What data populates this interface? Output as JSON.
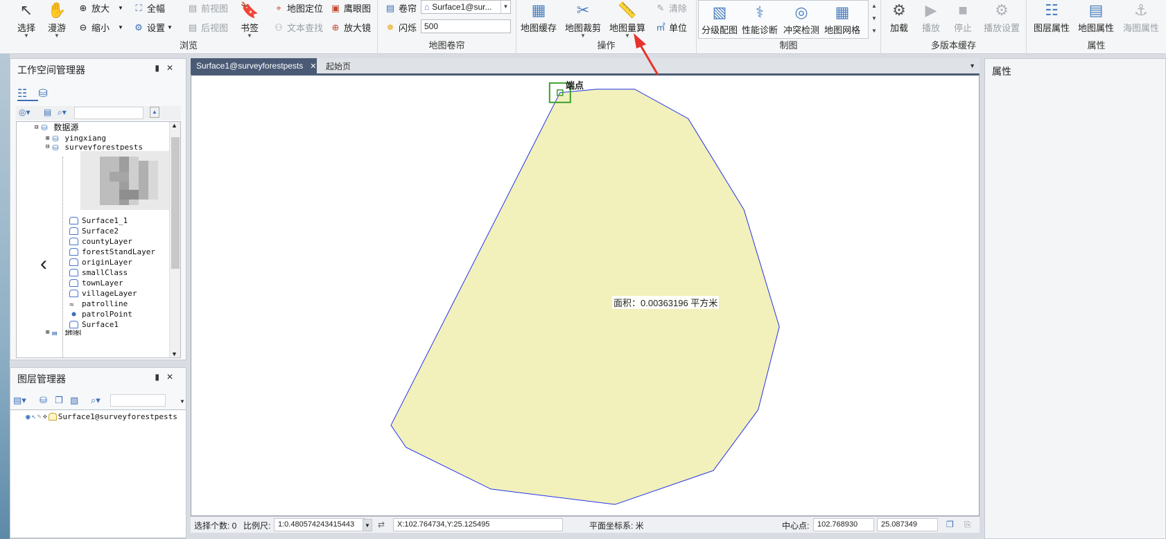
{
  "ribbon": {
    "browse": {
      "label": "浏览",
      "select": "选择",
      "pan": "漫游",
      "zoom_in": "放大",
      "zoom_out": "缩小",
      "full_extent": "全幅",
      "settings": "设置",
      "prev_view": "前视图",
      "next_view": "后视图",
      "bookmark": "书签",
      "locate": "地图定位",
      "eagle_eye": "鹰眼图",
      "text_search": "文本查找",
      "magnifier": "放大镜"
    },
    "swipe": {
      "label": "地图卷帘",
      "swipe": "卷帘",
      "layer_value": "Surface1@sur...",
      "flash": "闪烁",
      "flash_value": "500"
    },
    "ops": {
      "label": "操作",
      "map_cache": "地图缓存",
      "map_clip": "地图裁剪",
      "map_measure": "地图量算",
      "clear": "清除",
      "unit": "单位"
    },
    "mapping": {
      "label": "制图",
      "grade_map": "分级配图",
      "perf_diag": "性能诊断",
      "conflict": "冲突检测",
      "grid": "地图网格"
    },
    "multicache": {
      "label": "多版本缓存",
      "load": "加载",
      "play": "播放",
      "stop": "停止",
      "play_settings": "播放设置"
    },
    "props": {
      "label": "属性",
      "layer_props": "图层属性",
      "map_props": "地图属性",
      "chart_props": "海图属性"
    }
  },
  "workspace": {
    "title": "工作空间管理器",
    "datasource_label": "数据源",
    "items": [
      {
        "label": "yingxiang"
      },
      {
        "label": "surveyforestpests"
      },
      {
        "label": "Surface1_1"
      },
      {
        "label": "Surface2"
      },
      {
        "label": "countyLayer"
      },
      {
        "label": "forestStandLayer"
      },
      {
        "label": "originLayer"
      },
      {
        "label": "smallClass"
      },
      {
        "label": "townLayer"
      },
      {
        "label": "villageLayer"
      },
      {
        "label": "patrolline"
      },
      {
        "label": "patrolPoint"
      },
      {
        "label": "Surface1"
      },
      {
        "label": "地图"
      }
    ]
  },
  "layers": {
    "title": "图层管理器",
    "layer_name": "Surface1@surveyforestpests"
  },
  "tabs": [
    {
      "label": "Surface1@surveyforestpests"
    },
    {
      "label": "起始页"
    }
  ],
  "map": {
    "endpoint_label": "端点",
    "area_label": "面积：0.00363196 平方米",
    "fill_color": "#f2f0bb",
    "stroke_color": "#2233ee",
    "polygon": [
      [
        0.469,
        0.039
      ],
      [
        0.516,
        0.031
      ],
      [
        0.564,
        0.031
      ],
      [
        0.632,
        0.098
      ],
      [
        0.703,
        0.305
      ],
      [
        0.748,
        0.571
      ],
      [
        0.721,
        0.76
      ],
      [
        0.664,
        0.898
      ],
      [
        0.539,
        0.975
      ],
      [
        0.381,
        0.94
      ],
      [
        0.273,
        0.845
      ],
      [
        0.254,
        0.795
      ]
    ],
    "measure_point_color": "#3aa02a"
  },
  "properties": {
    "title": "属性"
  },
  "status": {
    "selected": "选择个数: 0",
    "scale_label": "比例尺:",
    "scale_value": "1:0.480574243415443",
    "coords": "X:102.764734,Y:25.125495",
    "crs": "平面坐标系: 米",
    "center_label": "中心点:",
    "center_x": "102.768930",
    "center_y": "25.087349"
  }
}
